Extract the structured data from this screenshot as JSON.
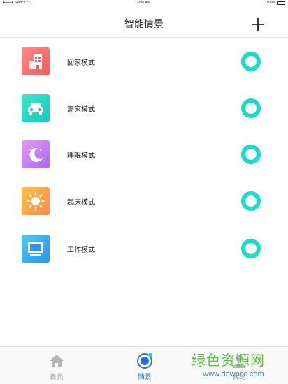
{
  "status_bar": {
    "carrier": "Sketch",
    "time": "9:41 AM",
    "battery": "100%"
  },
  "header": {
    "title": "智能情景",
    "add_icon": "plus-icon"
  },
  "accent_color": "#19dcc6",
  "scenes": [
    {
      "label": "回家模式",
      "icon": "building-icon",
      "colors": [
        "#ff7a8a",
        "#f25b5b"
      ],
      "enabled": true
    },
    {
      "label": "离家模式",
      "icon": "car-icon",
      "colors": [
        "#3ee6c9",
        "#14c9c0"
      ],
      "enabled": true
    },
    {
      "label": "睡眠模式",
      "icon": "moon-icon",
      "colors": [
        "#d98bf2",
        "#a86af0"
      ],
      "enabled": true
    },
    {
      "label": "起床模式",
      "icon": "sun-icon",
      "colors": [
        "#ffc04d",
        "#ff8a4a"
      ],
      "enabled": true
    },
    {
      "label": "工作模式",
      "icon": "monitor-icon",
      "colors": [
        "#4ec8f5",
        "#2b95ea"
      ],
      "enabled": true
    }
  ],
  "tabs": [
    {
      "label": "首页",
      "icon": "home-icon",
      "active": false
    },
    {
      "label": "情景",
      "icon": "scene-icon",
      "active": true
    },
    {
      "label": "我的",
      "icon": "user-icon",
      "active": false
    }
  ],
  "watermark": {
    "text": "绿色资源网",
    "url": "www.downcc.com"
  }
}
